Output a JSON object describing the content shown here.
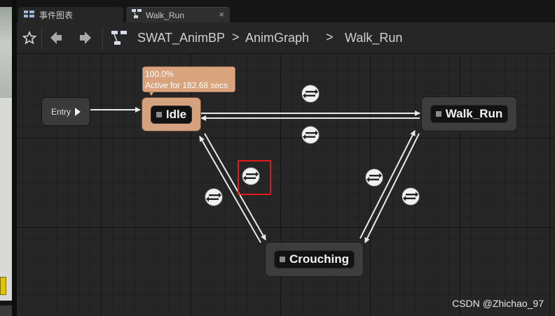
{
  "tabs": [
    {
      "label": "事件图表",
      "icon": "event-graph-icon"
    },
    {
      "label": "Walk_Run",
      "icon": "state-machine-icon",
      "close": "×"
    }
  ],
  "breadcrumb": [
    "SWAT_AnimBP",
    "AnimGraph",
    "Walk_Run"
  ],
  "breadcrumb_separator": ">",
  "toolbar_icons": [
    "star-icon",
    "back-arrow-icon",
    "forward-arrow-icon",
    "state-machine-icon"
  ],
  "graph": {
    "entry_label": "Entry",
    "states": [
      {
        "id": "idle",
        "label": "Idle",
        "active": true
      },
      {
        "id": "walk_run",
        "label": "Walk_Run"
      },
      {
        "id": "crouching",
        "label": "Crouching"
      }
    ],
    "tooltip": {
      "line1": "100.0%",
      "line2": "Active for 182.68 secs"
    },
    "transition_icon": "transition-rule-icon"
  },
  "watermark": "CSDN @Zhichao_97",
  "colors": {
    "active_state": "#d4a27e",
    "highlight": "#e01a1a",
    "wire": "#e8e8e8"
  }
}
